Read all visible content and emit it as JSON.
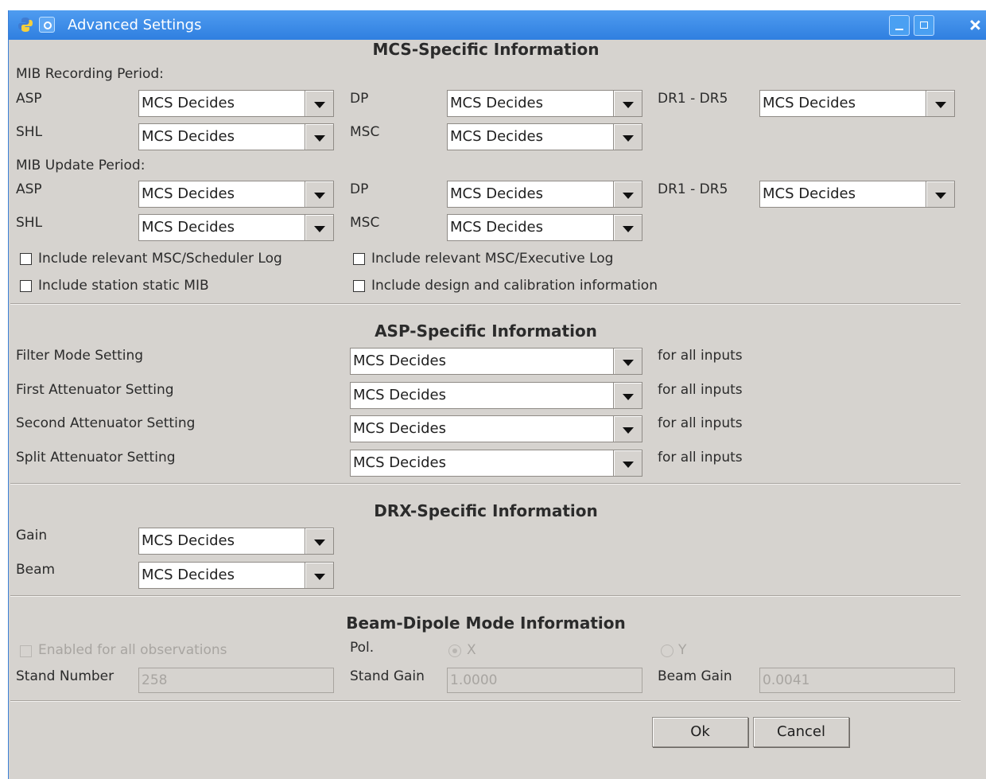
{
  "window": {
    "title": "Advanced Settings",
    "accent_color": "#3a8ee6",
    "background_color": "#d6d3cf",
    "icons": [
      "python-icon",
      "menu-icon",
      "minimize-icon",
      "maximize-icon",
      "close-icon"
    ]
  },
  "mcs": {
    "section_title": "MCS-Specific Information",
    "recording": {
      "heading": "MIB Recording Period:",
      "asp_label": "ASP",
      "asp_value": "MCS Decides",
      "dp_label": "DP",
      "dp_value": "MCS Decides",
      "dr_label": "DR1 - DR5",
      "dr_value": "MCS Decides",
      "shl_label": "SHL",
      "shl_value": "MCS Decides",
      "msc_label": "MSC",
      "msc_value": "MCS Decides"
    },
    "update": {
      "heading": "MIB Update Period:",
      "asp_label": "ASP",
      "asp_value": "MCS Decides",
      "dp_label": "DP",
      "dp_value": "MCS Decides",
      "dr_label": "DR1 - DR5",
      "dr_value": "MCS Decides",
      "shl_label": "SHL",
      "shl_value": "MCS Decides",
      "msc_label": "MSC",
      "msc_value": "MCS Decides"
    },
    "checkboxes": {
      "scheduler_log": "Include relevant MSC/Scheduler Log",
      "executive_log": "Include relevant MSC/Executive Log",
      "static_mib": "Include station static MIB",
      "design_cal": "Include design and calibration information"
    }
  },
  "asp": {
    "section_title": "ASP-Specific Information",
    "rows": [
      {
        "label": "Filter Mode Setting",
        "value": "MCS Decides",
        "suffix": "for all inputs"
      },
      {
        "label": "First Attenuator Setting",
        "value": "MCS Decides",
        "suffix": "for all inputs"
      },
      {
        "label": "Second Attenuator Setting",
        "value": "MCS Decides",
        "suffix": "for all inputs"
      },
      {
        "label": "Split Attenuator Setting",
        "value": "MCS Decides",
        "suffix": "for all inputs"
      }
    ]
  },
  "drx": {
    "section_title": "DRX-Specific Information",
    "gain_label": "Gain",
    "gain_value": "MCS Decides",
    "beam_label": "Beam",
    "beam_value": "MCS Decides"
  },
  "beam_dipole": {
    "section_title": "Beam-Dipole Mode Information",
    "enabled_label": "Enabled for all observations",
    "pol_label": "Pol.",
    "pol_x": "X",
    "pol_y": "Y",
    "stand_number_label": "Stand Number",
    "stand_number_value": "258",
    "stand_gain_label": "Stand Gain",
    "stand_gain_value": "1.0000",
    "beam_gain_label": "Beam Gain",
    "beam_gain_value": "0.0041"
  },
  "buttons": {
    "ok": "Ok",
    "cancel": "Cancel"
  }
}
